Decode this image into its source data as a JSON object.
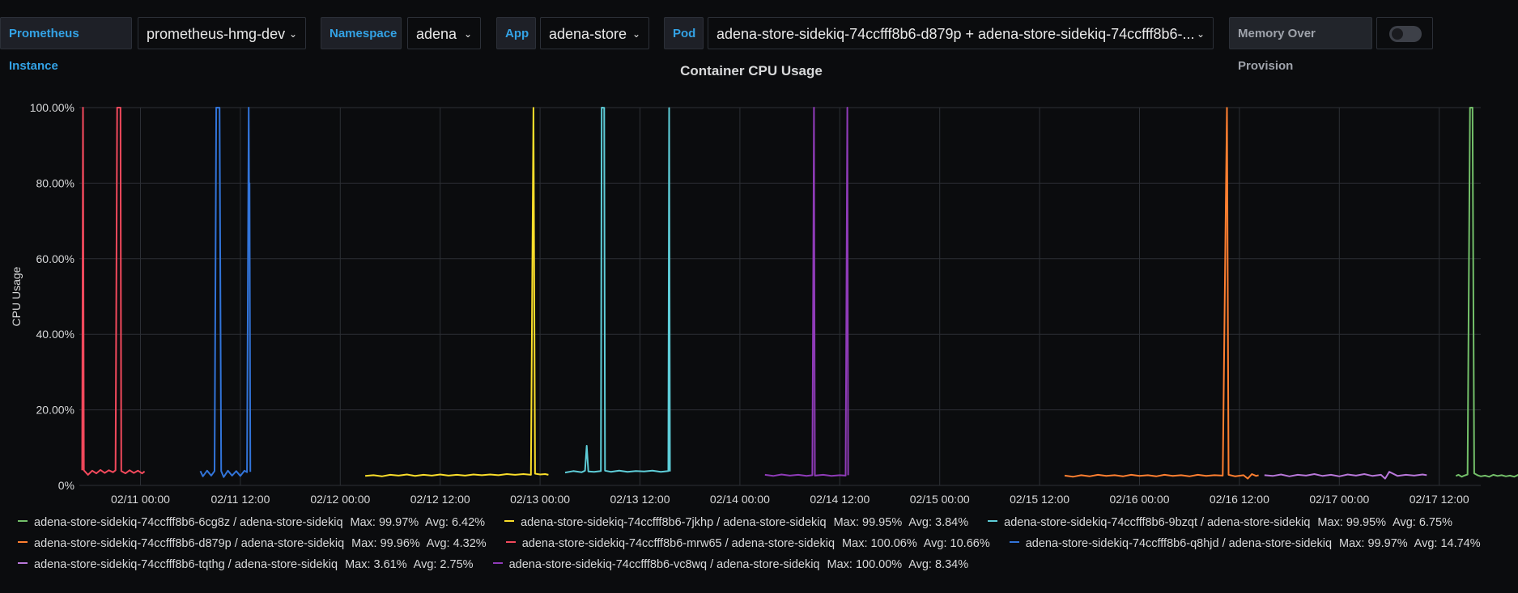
{
  "toolbar": {
    "instance": {
      "label": "Prometheus Instance",
      "value": "prometheus-hmg-dev"
    },
    "namespace": {
      "label": "Namespace",
      "value": "adena"
    },
    "app": {
      "label": "App",
      "value": "adena-store"
    },
    "pod": {
      "label": "Pod",
      "value": "adena-store-sidekiq-74ccfff8b6-d879p + adena-store-sidekiq-74ccfff8b6-..."
    },
    "memory": {
      "label": "Memory Over Provision"
    },
    "chevron": "⌄"
  },
  "chart_data": {
    "type": "line",
    "title": "Container CPU Usage",
    "ylabel": "CPU Usage",
    "xlabel": "",
    "ylim": [
      0,
      100
    ],
    "yticks": [
      "0%",
      "20.00%",
      "40.00%",
      "60.00%",
      "80.00%",
      "100.00%"
    ],
    "xticks": [
      "02/11 00:00",
      "02/11 12:00",
      "02/12 00:00",
      "02/12 12:00",
      "02/13 00:00",
      "02/13 12:00",
      "02/14 00:00",
      "02/14 12:00",
      "02/15 00:00",
      "02/15 12:00",
      "02/16 00:00",
      "02/16 12:00",
      "02/17 00:00",
      "02/17 12:00"
    ],
    "x_unit": "hours since 02/11 00:00",
    "grid": true,
    "legend_position": "bottom",
    "series": [
      {
        "name": "adena-store-sidekiq-74ccfff8b6-6cg8z / adena-store-sidekiq",
        "max": "Max: 99.97%",
        "avg": "Avg: 6.42%",
        "color": "#73bf69",
        "points": [
          [
            158.0,
            2.5
          ],
          [
            158.3,
            2.8
          ],
          [
            158.7,
            2.3
          ],
          [
            159.0,
            2.6
          ],
          [
            159.4,
            2.9
          ],
          [
            159.7,
            99.97
          ],
          [
            160.0,
            100.0
          ],
          [
            160.2,
            3.2
          ],
          [
            160.6,
            2.7
          ],
          [
            161.0,
            2.4
          ],
          [
            161.5,
            2.6
          ],
          [
            162.0,
            2.3
          ],
          [
            162.5,
            2.8
          ],
          [
            163.0,
            2.5
          ],
          [
            163.5,
            2.7
          ],
          [
            164.0,
            2.4
          ],
          [
            164.5,
            2.6
          ],
          [
            165.0,
            2.3
          ],
          [
            165.5,
            2.8
          ],
          [
            166.0,
            2.5
          ],
          [
            166.5,
            2.7
          ],
          [
            167.0,
            2.4
          ],
          [
            167.5,
            2.6
          ],
          [
            167.9,
            2.5
          ]
        ]
      },
      {
        "name": "adena-store-sidekiq-74ccfff8b6-7jkhp / adena-store-sidekiq",
        "max": "Max: 99.95%",
        "avg": "Avg: 3.84%",
        "color": "#fade2a",
        "points": [
          [
            27.0,
            2.5
          ],
          [
            28.0,
            2.7
          ],
          [
            29.0,
            2.4
          ],
          [
            30.0,
            2.8
          ],
          [
            31.0,
            2.6
          ],
          [
            32.0,
            2.9
          ],
          [
            33.0,
            2.5
          ],
          [
            34.0,
            2.8
          ],
          [
            35.0,
            2.6
          ],
          [
            36.0,
            2.9
          ],
          [
            37.0,
            2.6
          ],
          [
            38.0,
            2.8
          ],
          [
            39.0,
            2.6
          ],
          [
            40.0,
            2.9
          ],
          [
            41.0,
            2.7
          ],
          [
            42.0,
            2.9
          ],
          [
            43.0,
            2.7
          ],
          [
            44.0,
            3.0
          ],
          [
            45.0,
            2.8
          ],
          [
            46.0,
            3.0
          ],
          [
            46.9,
            2.8
          ],
          [
            47.2,
            99.95
          ],
          [
            47.4,
            3.1
          ],
          [
            48.0,
            2.9
          ],
          [
            48.6,
            3.0
          ],
          [
            49.0,
            2.8
          ]
        ]
      },
      {
        "name": "adena-store-sidekiq-74ccfff8b6-9bzqt / adena-store-sidekiq",
        "max": "Max: 99.95%",
        "avg": "Avg: 6.75%",
        "color": "#5ecdd8",
        "points": [
          [
            51.0,
            3.4
          ],
          [
            52.0,
            3.8
          ],
          [
            53.0,
            3.5
          ],
          [
            53.4,
            3.9
          ],
          [
            53.6,
            10.5
          ],
          [
            53.8,
            3.7
          ],
          [
            54.5,
            3.6
          ],
          [
            55.3,
            3.8
          ],
          [
            55.4,
            100.0
          ],
          [
            55.7,
            99.95
          ],
          [
            55.8,
            3.9
          ],
          [
            56.5,
            3.6
          ],
          [
            57.5,
            3.9
          ],
          [
            58.5,
            3.6
          ],
          [
            59.5,
            3.8
          ],
          [
            60.5,
            3.7
          ],
          [
            61.5,
            3.9
          ],
          [
            62.5,
            3.6
          ],
          [
            63.4,
            3.8
          ],
          [
            63.5,
            99.9
          ],
          [
            63.6,
            3.7
          ]
        ]
      },
      {
        "name": "adena-store-sidekiq-74ccfff8b6-d879p / adena-store-sidekiq",
        "max": "Max: 99.96%",
        "avg": "Avg: 4.32%",
        "color": "#ff7f30",
        "points": [
          [
            111.0,
            2.6
          ],
          [
            112.0,
            2.3
          ],
          [
            113.0,
            2.7
          ],
          [
            114.0,
            2.4
          ],
          [
            115.0,
            2.8
          ],
          [
            116.0,
            2.5
          ],
          [
            117.0,
            2.7
          ],
          [
            118.0,
            2.4
          ],
          [
            119.0,
            2.8
          ],
          [
            120.0,
            2.5
          ],
          [
            121.0,
            2.7
          ],
          [
            122.0,
            2.4
          ],
          [
            123.0,
            2.8
          ],
          [
            124.0,
            2.5
          ],
          [
            125.0,
            2.7
          ],
          [
            126.0,
            2.4
          ],
          [
            127.0,
            2.8
          ],
          [
            128.0,
            2.5
          ],
          [
            129.0,
            2.7
          ],
          [
            130.0,
            2.6
          ],
          [
            130.4,
            80.0
          ],
          [
            130.5,
            99.96
          ],
          [
            130.7,
            2.8
          ],
          [
            131.5,
            2.4
          ],
          [
            132.5,
            2.7
          ],
          [
            133.0,
            1.8
          ],
          [
            133.5,
            3.0
          ],
          [
            134.0,
            2.5
          ],
          [
            134.3,
            2.7
          ]
        ]
      },
      {
        "name": "adena-store-sidekiq-74ccfff8b6-mrw65 / adena-store-sidekiq",
        "max": "Max: 100.06%",
        "avg": "Avg: 10.66%",
        "color": "#f2495c",
        "points": [
          [
            -7.0,
            4.0
          ],
          [
            -6.9,
            100.06
          ],
          [
            -6.8,
            4.0
          ],
          [
            -6.3,
            2.8
          ],
          [
            -5.8,
            3.9
          ],
          [
            -5.3,
            3.2
          ],
          [
            -4.8,
            4.1
          ],
          [
            -4.3,
            3.3
          ],
          [
            -3.8,
            4.0
          ],
          [
            -3.3,
            3.5
          ],
          [
            -3.0,
            4.0
          ],
          [
            -2.8,
            100.0
          ],
          [
            -2.4,
            100.0
          ],
          [
            -2.3,
            3.8
          ],
          [
            -1.8,
            3.2
          ],
          [
            -1.3,
            4.0
          ],
          [
            -0.8,
            3.3
          ],
          [
            -0.3,
            3.9
          ],
          [
            0.2,
            3.2
          ],
          [
            0.5,
            3.7
          ]
        ]
      },
      {
        "name": "adena-store-sidekiq-74ccfff8b6-q8hjd / adena-store-sidekiq",
        "max": "Max: 99.97%",
        "avg": "Avg: 14.74%",
        "color": "#3274d9",
        "points": [
          [
            7.2,
            3.8
          ],
          [
            7.5,
            2.4
          ],
          [
            8.0,
            3.9
          ],
          [
            8.5,
            2.6
          ],
          [
            8.9,
            3.8
          ],
          [
            9.1,
            100.0
          ],
          [
            9.5,
            99.97
          ],
          [
            9.7,
            3.8
          ],
          [
            10.0,
            2.2
          ],
          [
            10.5,
            3.9
          ],
          [
            11.0,
            2.6
          ],
          [
            11.5,
            3.8
          ],
          [
            12.0,
            2.5
          ],
          [
            12.5,
            3.9
          ],
          [
            12.8,
            3.5
          ],
          [
            13.0,
            100.0
          ],
          [
            13.05,
            77.0
          ],
          [
            13.1,
            80.0
          ],
          [
            13.2,
            3.6
          ]
        ]
      },
      {
        "name": "adena-store-sidekiq-74ccfff8b6-tqthg / adena-store-sidekiq",
        "max": "Max: 3.61%",
        "avg": "Avg: 2.75%",
        "color": "#b877d9",
        "points": [
          [
            135.0,
            2.7
          ],
          [
            136.0,
            2.5
          ],
          [
            137.0,
            2.9
          ],
          [
            138.0,
            2.4
          ],
          [
            139.0,
            2.8
          ],
          [
            140.0,
            2.6
          ],
          [
            141.0,
            3.0
          ],
          [
            142.0,
            2.5
          ],
          [
            143.0,
            2.8
          ],
          [
            144.0,
            2.4
          ],
          [
            145.0,
            2.9
          ],
          [
            146.0,
            2.6
          ],
          [
            147.0,
            3.0
          ],
          [
            148.0,
            2.5
          ],
          [
            149.0,
            2.8
          ],
          [
            149.5,
            1.8
          ],
          [
            150.0,
            3.6
          ],
          [
            151.0,
            2.5
          ],
          [
            152.0,
            2.8
          ],
          [
            153.0,
            2.6
          ],
          [
            154.0,
            2.9
          ],
          [
            154.5,
            2.7
          ]
        ]
      },
      {
        "name": "adena-store-sidekiq-74ccfff8b6-vc8wq / adena-store-sidekiq",
        "max": "Max: 100.00%",
        "avg": "Avg: 8.34%",
        "color": "#8f3bb8",
        "points": [
          [
            75.0,
            2.8
          ],
          [
            76.0,
            2.5
          ],
          [
            77.0,
            2.9
          ],
          [
            78.0,
            2.6
          ],
          [
            79.0,
            2.8
          ],
          [
            80.0,
            2.5
          ],
          [
            80.7,
            2.7
          ],
          [
            80.9,
            100.0
          ],
          [
            81.0,
            2.6
          ],
          [
            82.0,
            2.8
          ],
          [
            83.0,
            2.5
          ],
          [
            84.0,
            2.7
          ],
          [
            84.7,
            2.6
          ],
          [
            84.9,
            100.0
          ],
          [
            85.0,
            2.7
          ]
        ]
      }
    ]
  }
}
